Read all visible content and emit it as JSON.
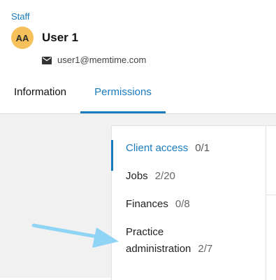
{
  "breadcrumb": "Staff",
  "user": {
    "initials": "AA",
    "name": "User 1",
    "email": "user1@memtime.com",
    "email_icon": "mail-icon"
  },
  "tabs": [
    {
      "label": "Information",
      "active": false
    },
    {
      "label": "Permissions",
      "active": true
    }
  ],
  "permissions_menu": [
    {
      "label": "Client access",
      "count": "0/1",
      "active": true
    },
    {
      "label": "Jobs",
      "count": "2/20",
      "active": false
    },
    {
      "label": "Finances",
      "count": "0/8",
      "active": false
    },
    {
      "label_line1": "Practice",
      "label_line2": "administration",
      "count": "2/7",
      "active": false
    }
  ],
  "annotation": {
    "icon": "pointer-arrow-icon",
    "color": "#8fd3f5"
  },
  "colors": {
    "accent": "#1a7bbf",
    "avatar": "#f6c15a",
    "content_background": "#f1f1f1"
  }
}
